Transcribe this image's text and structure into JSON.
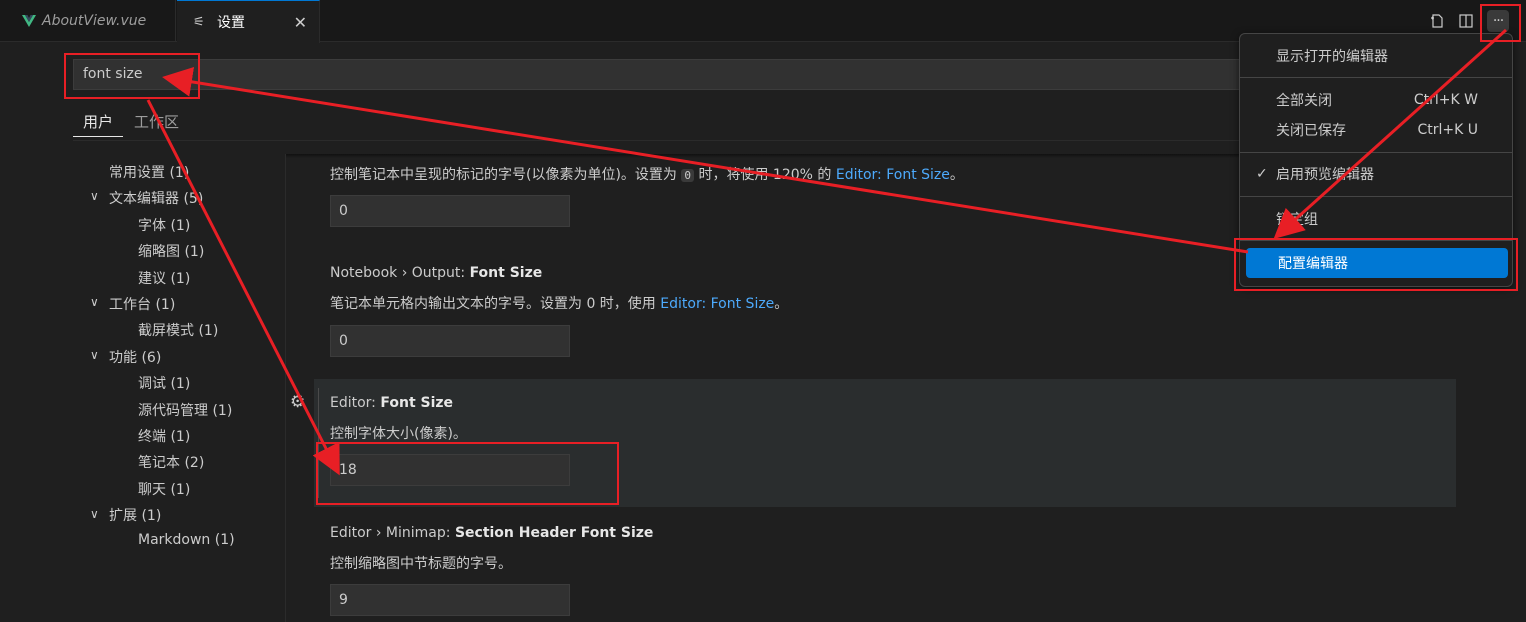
{
  "tabs": [
    {
      "label": "AboutView.vue",
      "icon": "vue-icon"
    },
    {
      "label": "设置",
      "icon": "settings-icon",
      "close": "✕"
    }
  ],
  "toolbar": {
    "open_changes_icon": "open-changes-icon",
    "split_icon": "split-editor-icon",
    "more_icon": "more-actions-icon",
    "more_label": "···"
  },
  "search": {
    "value": "font size"
  },
  "scopes": {
    "user": "用户",
    "workspace": "工作区"
  },
  "toc": {
    "common": "常用设置 (1)",
    "text_editor": "文本编辑器 (5)",
    "font": "字体 (1)",
    "minimap": "缩略图 (1)",
    "suggest": "建议 (1)",
    "workbench": "工作台 (1)",
    "screencast": "截屏模式 (1)",
    "features": "功能 (6)",
    "debug": "调试 (1)",
    "scm": "源代码管理 (1)",
    "terminal": "终端 (1)",
    "notebook": "笔记本 (2)",
    "chat": "聊天 (1)",
    "extensions": "扩展 (1)",
    "markdown": "Markdown (1)"
  },
  "settings": {
    "s1": {
      "desc_prefix": "控制笔记本中呈现的标记的字号(以像素为单位)。设置为",
      "desc_code": "0",
      "desc_mid": "时，将使用 120% 的",
      "desc_link": "Editor: Font Size",
      "desc_suffix": "。",
      "value": "0"
    },
    "s2": {
      "title_prefix": "Notebook › Output: ",
      "title_bold": "Font Size",
      "desc_prefix": "笔记本单元格内输出文本的字号。设置为 0 时，使用",
      "desc_link": "Editor: Font Size",
      "desc_suffix": "。",
      "value": "0"
    },
    "s3": {
      "title_prefix": "Editor: ",
      "title_bold": "Font Size",
      "desc": "控制字体大小(像素)。",
      "value": "18"
    },
    "s4": {
      "title_prefix": "Editor › Minimap: ",
      "title_bold": "Section Header Font Size",
      "desc": "控制缩略图中节标题的字号。",
      "value": "9"
    }
  },
  "menu": {
    "show_opened": "显示打开的编辑器",
    "close_all": "全部关闭",
    "close_all_shortcut": "Ctrl+K W",
    "close_saved": "关闭已保存",
    "close_saved_shortcut": "Ctrl+K U",
    "preview": "启用预览编辑器",
    "preview_check": "✓",
    "lock_group": "锁定组",
    "configure": "配置编辑器"
  },
  "colors": {
    "accent": "#0078d4",
    "annotation": "#e81f25",
    "link": "#4daafc"
  }
}
